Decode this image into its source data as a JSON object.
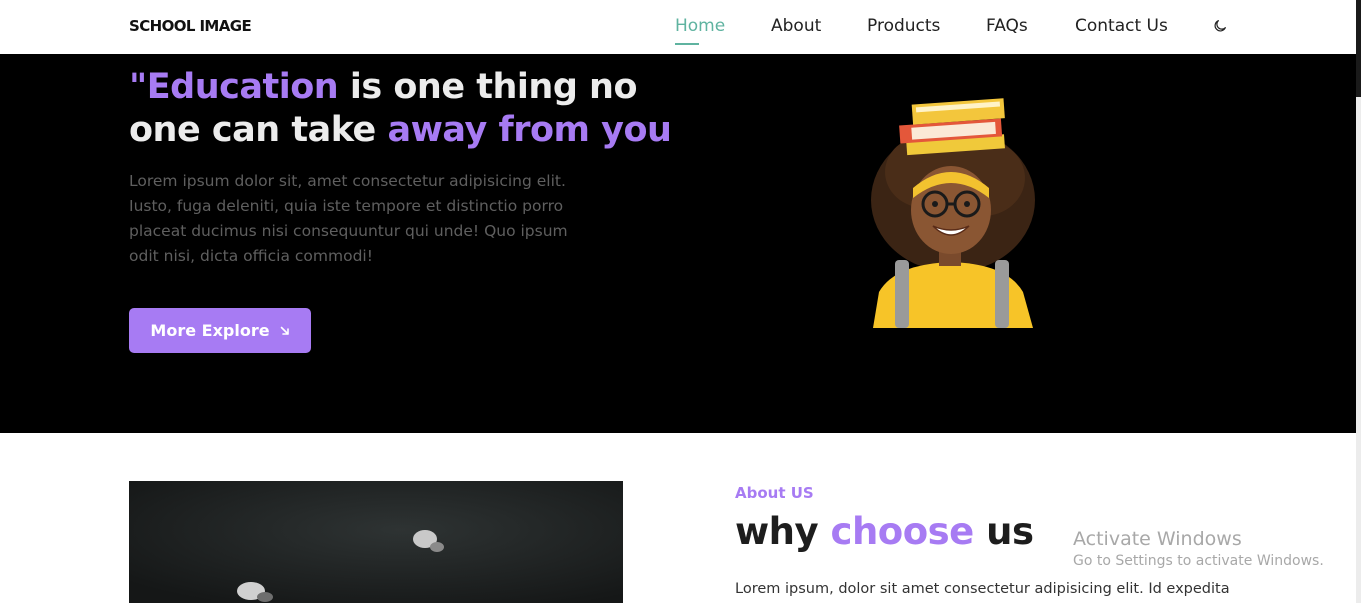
{
  "header": {
    "brand": "SCHOOL IMAGE",
    "nav": [
      {
        "label": "Home",
        "active": true
      },
      {
        "label": "About"
      },
      {
        "label": "Products"
      },
      {
        "label": "FAQs"
      },
      {
        "label": "Contact Us"
      }
    ],
    "theme_toggle_icon": "moon-icon"
  },
  "hero": {
    "title_part1": "\"Education",
    "title_part2": " is one thing no one can take ",
    "title_part3": "away from you",
    "text": "Lorem ipsum dolor sit, amet consectetur adipisicing elit. Iusto, fuga deleniti, quia iste tempore et distinctio porro placeat ducimus nisi consequuntur qui unde! Quo ipsum odit nisi, dicta officia commodi!",
    "button_label": "More Explore",
    "button_icon": "arrow-down-right-icon"
  },
  "about": {
    "kicker": "About US",
    "title_part1": "why ",
    "title_part2": "choose",
    "title_part3": " us",
    "text": "Lorem ipsum, dolor sit amet consectetur adipisicing elit. Id expedita"
  },
  "watermark": {
    "title": "Activate Windows",
    "subtitle": "Go to Settings to activate Windows."
  },
  "colors": {
    "accent": "#a77bf3",
    "nav_active": "#5fb3a0",
    "hero_bg": "#000000"
  }
}
